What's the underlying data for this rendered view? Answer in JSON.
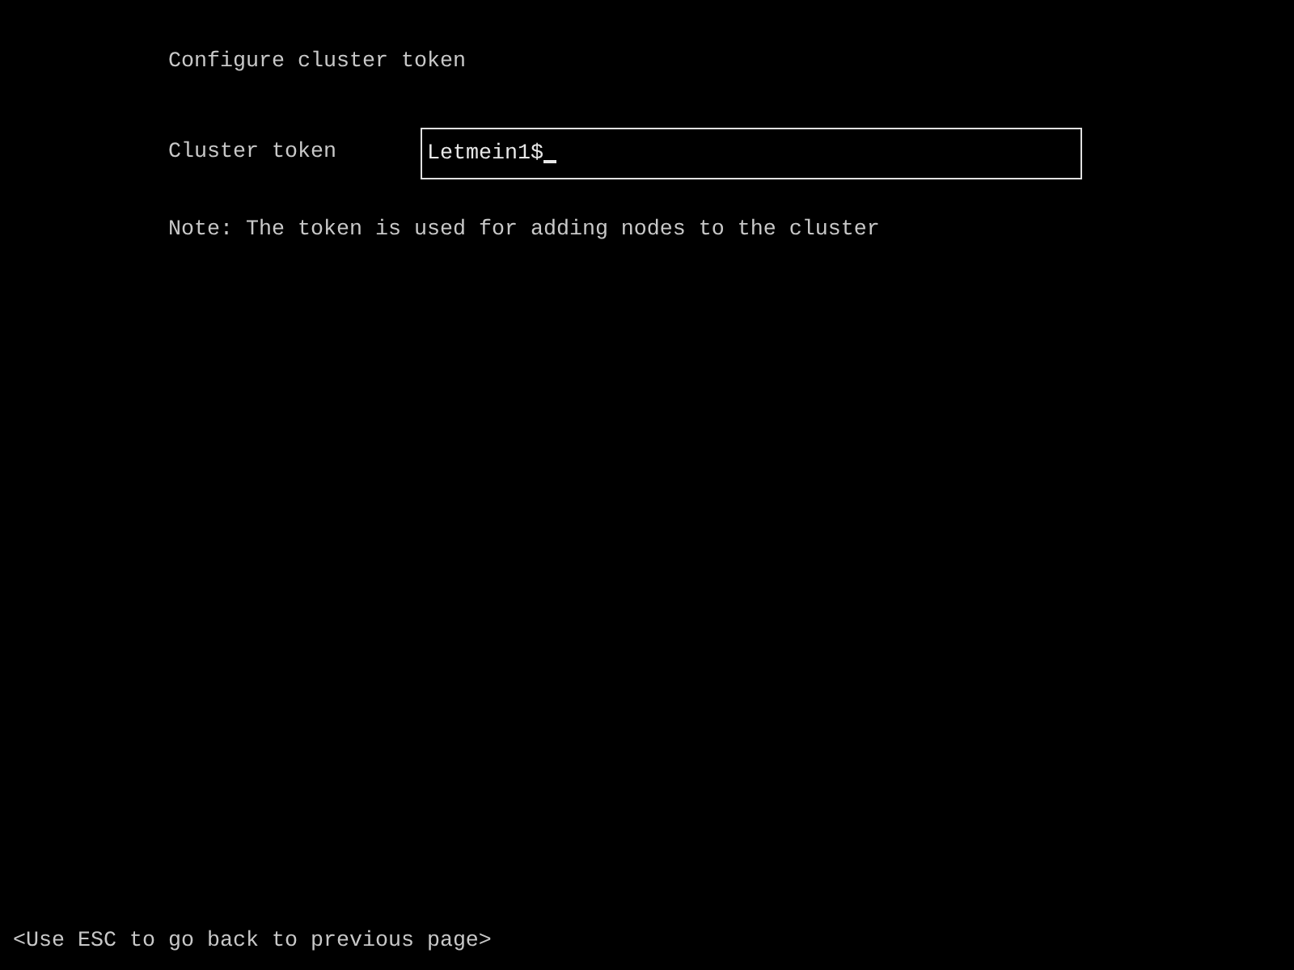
{
  "title": "Configure cluster token",
  "field": {
    "label": "Cluster token",
    "value": "Letmein1$",
    "focused": true
  },
  "note": "Note: The token is used for adding nodes to the cluster",
  "footer": "<Use ESC to go back to previous page>"
}
